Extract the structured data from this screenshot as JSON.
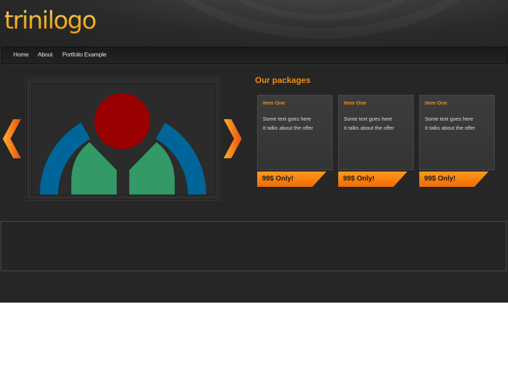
{
  "brand": {
    "logo_text": "trinilogo",
    "accent": "#f08c10",
    "logo_color": "#f4ae20"
  },
  "nav": {
    "items": [
      "Home",
      "About",
      "Portfolio Example"
    ]
  },
  "slider": {
    "prev_icon": "chevron-left-icon",
    "next_icon": "chevron-right-icon",
    "image": "wikimedia-logo"
  },
  "packages": {
    "title": "Our packages",
    "items": [
      {
        "name": "Item One",
        "line1": "Some text goes here",
        "line2": "It talks about the offer",
        "price": "99$ Only!"
      },
      {
        "name": "Item One",
        "line1": "Some text goes here",
        "line2": "It talks about the offer",
        "price": "99$ Only!"
      },
      {
        "name": "Item One",
        "line1": "Some text goes here",
        "line2": "It talks about the offer",
        "price": "99$ Only!"
      }
    ]
  }
}
